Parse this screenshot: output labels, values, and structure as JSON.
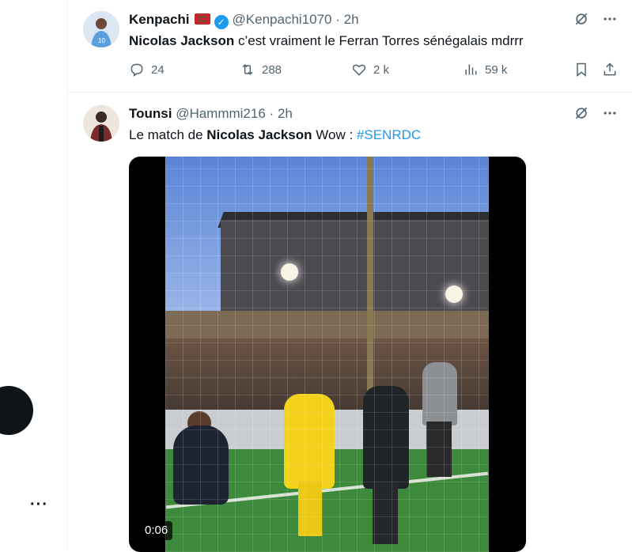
{
  "tweets": [
    {
      "display_name": "Kenpachi",
      "handle": "@Kenpachi1070",
      "separator": "·",
      "time": "2h",
      "text_bold": "Nicolas Jackson",
      "text_rest": " c’est vraiment le Ferran Torres sénégalais mdrrr",
      "stats": {
        "replies": "24",
        "retweets": "288",
        "likes": "2 k",
        "views": "59 k"
      }
    },
    {
      "display_name": "Tounsi",
      "handle": "@Hammmi216",
      "separator": "·",
      "time": "2h",
      "text_prefix": "Le match de ",
      "text_bold": "Nicolas Jackson",
      "text_mid": " Wow : ",
      "hashtag": "#SENRDC",
      "video_duration": "0:06"
    }
  ],
  "colors": {
    "accent": "#1d9bf0",
    "muted": "#536471",
    "text": "#0f1419"
  },
  "icons": {
    "grok": "grok-icon",
    "more": "more-icon",
    "reply": "reply-icon",
    "retweet": "retweet-icon",
    "like": "like-icon",
    "views": "views-icon",
    "bookmark": "bookmark-icon",
    "share": "share-icon"
  },
  "sidebar": {
    "more_label": "···"
  }
}
